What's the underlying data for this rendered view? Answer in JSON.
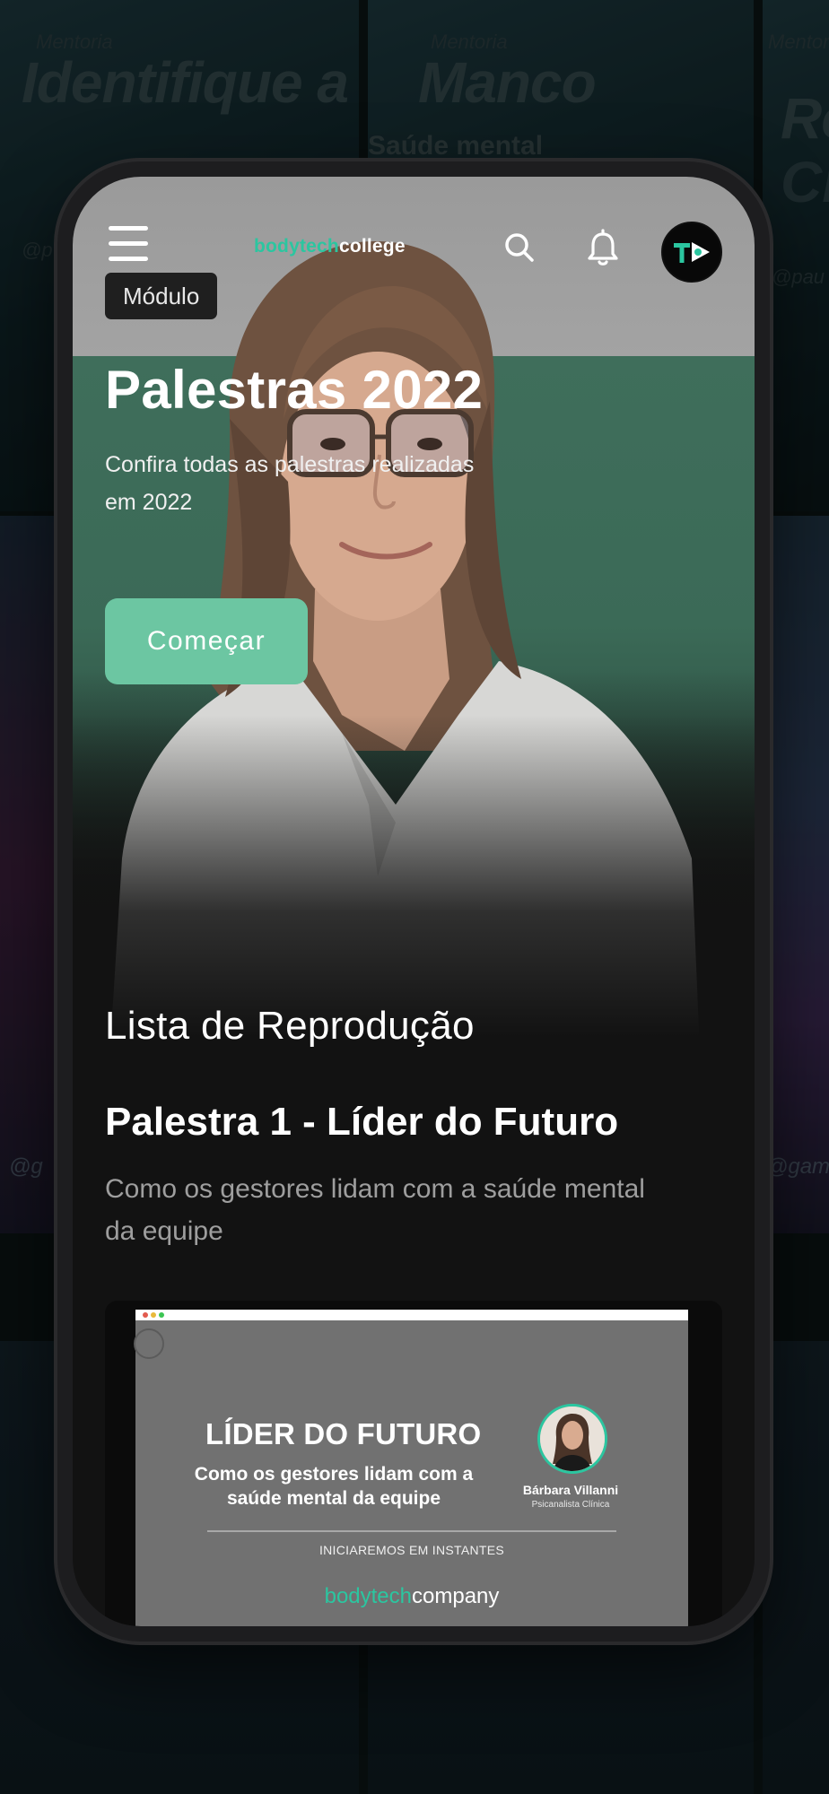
{
  "background": {
    "posters": [
      {
        "kicker": "Mentoria",
        "title": "Identifique a",
        "handle": "@p"
      },
      {
        "kicker": "Mentoria",
        "title": "Manco",
        "subtitle": "Saúde mental"
      },
      {
        "kicker": "Mentoria",
        "title": "Re",
        "title2": "Cr",
        "handle": "@pau"
      }
    ],
    "handles_row2": [
      "@g",
      "@gam"
    ]
  },
  "header": {
    "logo_part1": "bodytech",
    "logo_part2": "college",
    "menu_icon": "hamburger-icon",
    "search_icon": "search-icon",
    "bell_icon": "bell-icon",
    "avatar_text": "T"
  },
  "hero": {
    "badge": "Módulo",
    "title": "Palestras 2022",
    "subtitle": "Confira todas as palestras realizadas em 2022",
    "cta_label": "Começar"
  },
  "playlist": {
    "section_title": "Lista de Reprodução",
    "item_title": "Palestra 1 - Líder do Futuro",
    "item_description": "Como os gestores lidam com a saúde mental da equipe",
    "thumbnail": {
      "heading": "LÍDER DO FUTURO",
      "subheading": "Como os gestores lidam com a saúde mental da equipe",
      "presenter_name": "Bárbara Villanni",
      "presenter_role": "Psicanalista Clínica",
      "status": "INICIAREMOS EM INSTANTES",
      "brand_part1": "bodytech",
      "brand_part2": "company"
    }
  },
  "colors": {
    "accent": "#2bc6a0",
    "cta": "#6cc6a2",
    "screen_bg": "#121212"
  }
}
